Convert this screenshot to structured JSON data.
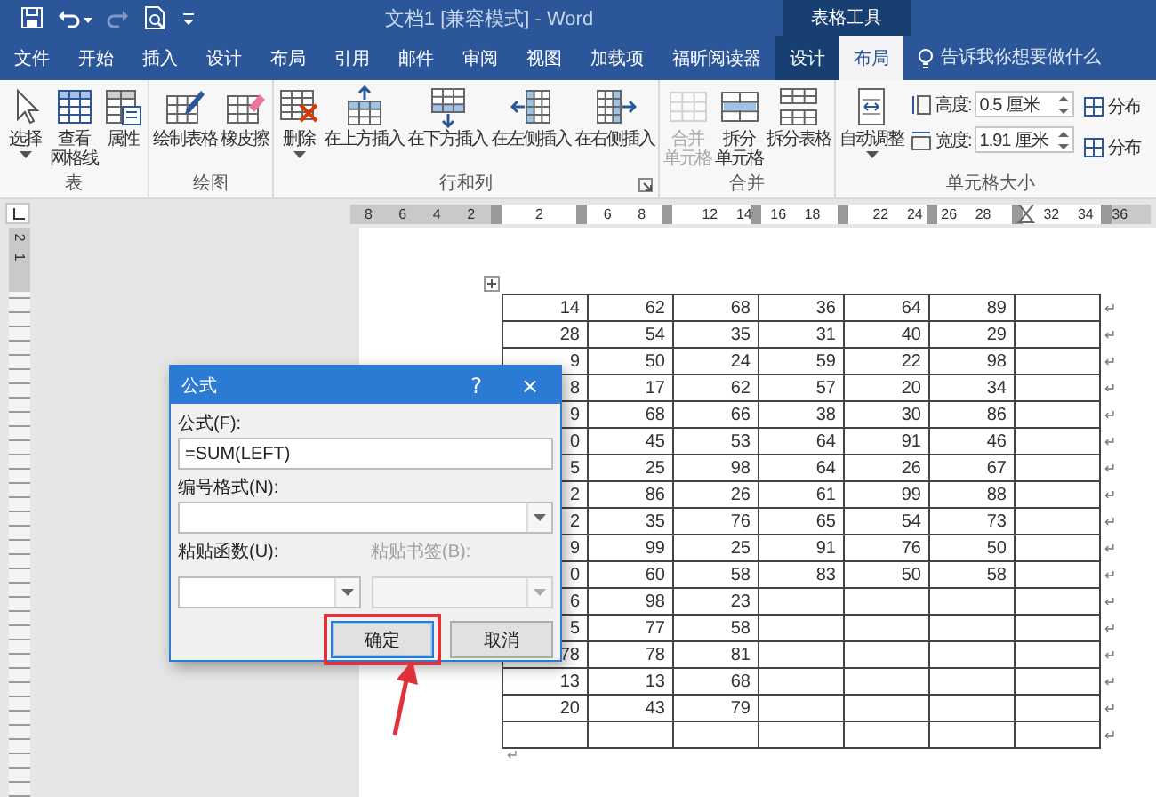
{
  "title_bar": {
    "quick_access": [
      {
        "disabled": false
      },
      {
        "disabled": false
      },
      {
        "disabled": true
      },
      {
        "disabled": false
      },
      {
        "disabled": false
      }
    ],
    "title": "文档1 [兼容模式] - Word",
    "context_label": "表格工具"
  },
  "tabs": [
    {
      "label": "文件",
      "selected": false,
      "contextual": false
    },
    {
      "label": "开始",
      "selected": false,
      "contextual": false
    },
    {
      "label": "插入",
      "selected": false,
      "contextual": false
    },
    {
      "label": "设计",
      "selected": false,
      "contextual": false
    },
    {
      "label": "布局",
      "selected": false,
      "contextual": false
    },
    {
      "label": "引用",
      "selected": false,
      "contextual": false
    },
    {
      "label": "邮件",
      "selected": false,
      "contextual": false
    },
    {
      "label": "审阅",
      "selected": false,
      "contextual": false
    },
    {
      "label": "视图",
      "selected": false,
      "contextual": false
    },
    {
      "label": "加载项",
      "selected": false,
      "contextual": false
    },
    {
      "label": "福昕阅读器",
      "selected": false,
      "contextual": false
    },
    {
      "label": "设计",
      "selected": false,
      "contextual": true
    },
    {
      "label": "布局",
      "selected": true,
      "contextual": true
    }
  ],
  "tell_me": {
    "placeholder": "告诉我你想要做什么"
  },
  "ribbon": {
    "groups": [
      {
        "label": "表",
        "launcher": false,
        "buttons": [
          {
            "lines": [
              "选择"
            ],
            "dropdown": true,
            "disabled": false
          },
          {
            "lines": [
              "查看",
              "网格线"
            ],
            "dropdown": false,
            "disabled": false
          },
          {
            "lines": [
              "属性"
            ],
            "dropdown": false,
            "disabled": false
          }
        ]
      },
      {
        "label": "绘图",
        "launcher": false,
        "buttons": [
          {
            "lines": [
              "绘制表格"
            ],
            "dropdown": false,
            "disabled": false
          },
          {
            "lines": [
              "橡皮擦"
            ],
            "dropdown": false,
            "disabled": false
          }
        ]
      },
      {
        "label": "行和列",
        "launcher": true,
        "buttons": [
          {
            "lines": [
              "删除"
            ],
            "dropdown": true,
            "disabled": false
          },
          {
            "lines": [
              "在上方插入"
            ],
            "dropdown": false,
            "disabled": false
          },
          {
            "lines": [
              "在下方插入"
            ],
            "dropdown": false,
            "disabled": false
          },
          {
            "lines": [
              "在左侧插入"
            ],
            "dropdown": false,
            "disabled": false
          },
          {
            "lines": [
              "在右侧插入"
            ],
            "dropdown": false,
            "disabled": false
          }
        ]
      },
      {
        "label": "合并",
        "launcher": false,
        "buttons": [
          {
            "lines": [
              "合并",
              "单元格"
            ],
            "dropdown": false,
            "disabled": true
          },
          {
            "lines": [
              "拆分",
              "单元格"
            ],
            "dropdown": false,
            "disabled": false
          },
          {
            "lines": [
              "拆分表格"
            ],
            "dropdown": false,
            "disabled": false
          }
        ]
      },
      {
        "label": "单元格大小",
        "launcher": false,
        "buttons": [
          {
            "lines": [
              "自动调整"
            ],
            "dropdown": true,
            "disabled": false
          }
        ],
        "size_fields": [
          {
            "label": "高度:",
            "value": "0.5 厘米"
          },
          {
            "label": "宽度:",
            "value": "1.91 厘米"
          }
        ],
        "distribute": [
          "分布",
          "分布"
        ]
      }
    ]
  },
  "ruler": {
    "labels": [
      "8",
      "6",
      "4",
      "2",
      "2",
      "6",
      "8",
      "12",
      "14",
      "16",
      "18",
      "22",
      "24",
      "26",
      "28",
      "32",
      "34",
      "36"
    ]
  },
  "vertical_ruler": {
    "labels": [
      "2",
      "1"
    ]
  },
  "table": {
    "rows": [
      {
        "cells": [
          "14",
          "62",
          "68",
          "36",
          "64",
          "89"
        ],
        "end_mark": "↵"
      },
      {
        "cells": [
          "28",
          "54",
          "35",
          "31",
          "40",
          "29"
        ],
        "end_mark": "↵"
      },
      {
        "cells": [
          "9",
          "50",
          "24",
          "59",
          "22",
          "98"
        ],
        "end_mark": "↵"
      },
      {
        "cells": [
          "8",
          "17",
          "62",
          "57",
          "20",
          "34"
        ],
        "end_mark": "↵"
      },
      {
        "cells": [
          "9",
          "68",
          "66",
          "38",
          "30",
          "86"
        ],
        "end_mark": "↵"
      },
      {
        "cells": [
          "0",
          "45",
          "53",
          "64",
          "91",
          "46"
        ],
        "end_mark": "↵"
      },
      {
        "cells": [
          "5",
          "25",
          "98",
          "64",
          "26",
          "67"
        ],
        "end_mark": "↵"
      },
      {
        "cells": [
          "2",
          "86",
          "26",
          "61",
          "99",
          "88"
        ],
        "end_mark": "↵"
      },
      {
        "cells": [
          "2",
          "35",
          "76",
          "65",
          "54",
          "73"
        ],
        "end_mark": "↵"
      },
      {
        "cells": [
          "9",
          "99",
          "25",
          "91",
          "76",
          "50"
        ],
        "end_mark": "↵"
      },
      {
        "cells": [
          "0",
          "60",
          "58",
          "83",
          "50",
          "58"
        ],
        "end_mark": "↵"
      },
      {
        "cells": [
          "6",
          "98",
          "23"
        ],
        "end_mark": "↵"
      },
      {
        "cells": [
          "5",
          "77",
          "58"
        ],
        "end_mark": "↵"
      },
      {
        "cells": [
          "78",
          "78",
          "81"
        ],
        "end_mark": "↵"
      },
      {
        "cells": [
          "13",
          "13",
          "68"
        ],
        "end_mark": "↵"
      },
      {
        "cells": [
          "20",
          "43",
          "79"
        ],
        "end_mark": "↵"
      },
      {
        "end_mark": "↵"
      }
    ],
    "after_table_mark": "↵"
  },
  "dialog": {
    "title": "公式",
    "help_button": "?",
    "close_button": "×",
    "formula": {
      "label": "公式(F):",
      "value": "=SUM(LEFT)"
    },
    "number_format": {
      "label": "编号格式(N):"
    },
    "paste_function": {
      "label": "粘贴函数(U):",
      "disabled": false
    },
    "paste_bookmark": {
      "label": "粘贴书签(B):",
      "disabled": true
    },
    "buttons": [
      {
        "label": "确定",
        "focused": true,
        "highlighted": true
      },
      {
        "label": "取消",
        "focused": false,
        "highlighted": false
      }
    ]
  },
  "pointer_arrow": true
}
